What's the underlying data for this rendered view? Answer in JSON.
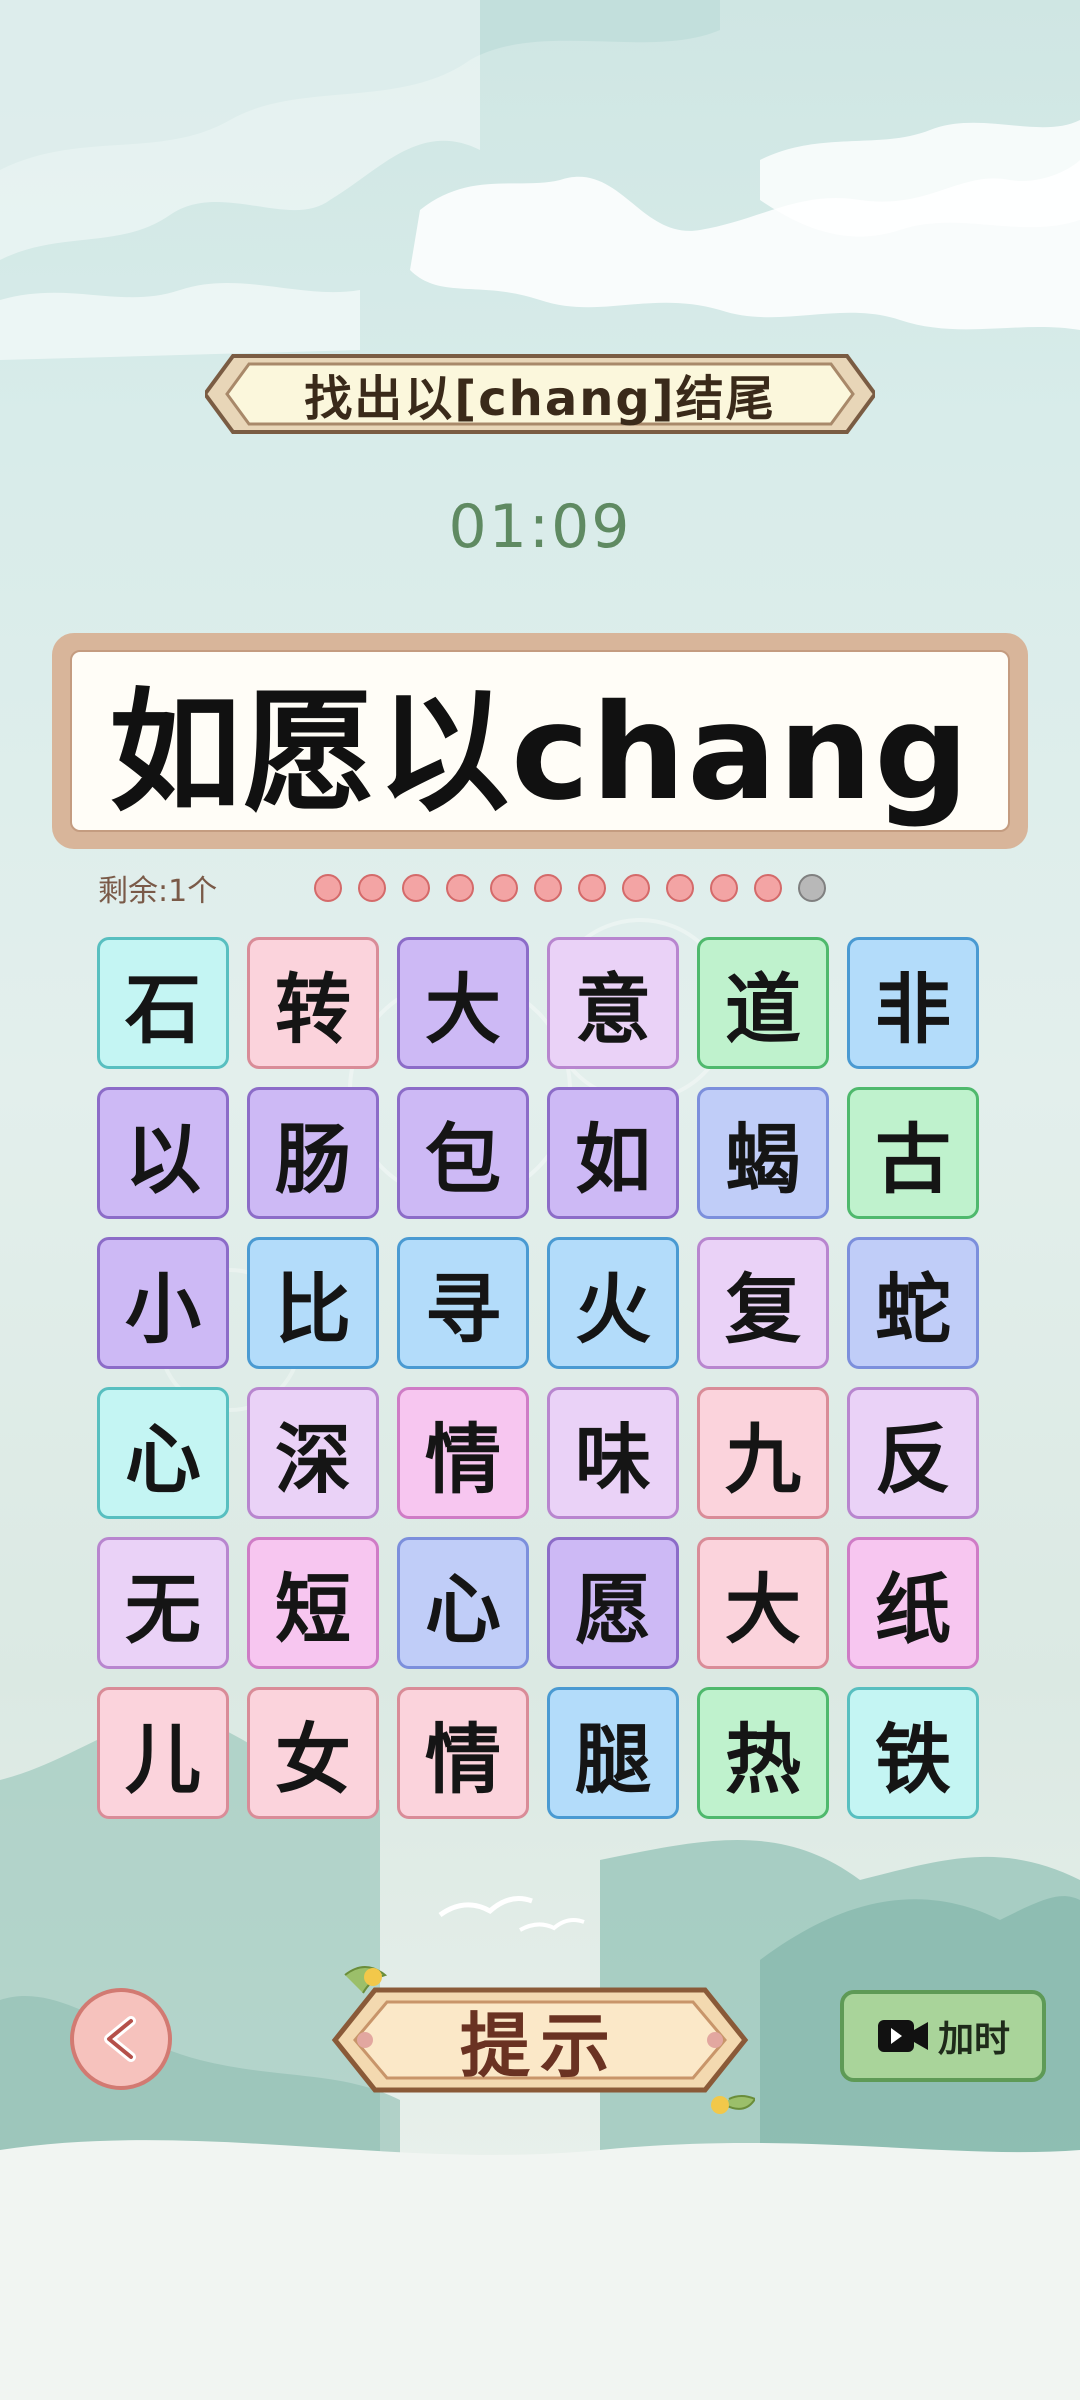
{
  "header": {
    "title": "找出以[chang]结尾",
    "timer": "01:09"
  },
  "answer": {
    "text": "如愿以chang"
  },
  "progress": {
    "remaining_label": "剩余:1个",
    "total": 12,
    "completed": 11
  },
  "grid": {
    "rows": [
      [
        "石",
        "转",
        "大",
        "意",
        "道",
        "非"
      ],
      [
        "以",
        "肠",
        "包",
        "如",
        "蝎",
        "古"
      ],
      [
        "小",
        "比",
        "寻",
        "火",
        "复",
        "蛇"
      ],
      [
        "心",
        "深",
        "情",
        "味",
        "九",
        "反"
      ],
      [
        "无",
        "短",
        "心",
        "愿",
        "大",
        "纸"
      ],
      [
        "儿",
        "女",
        "情",
        "腿",
        "热",
        "铁"
      ]
    ],
    "colors": [
      [
        "cyan",
        "pink",
        "purple",
        "lilac",
        "green",
        "blue"
      ],
      [
        "purple",
        "purple",
        "purple",
        "purple",
        "periw",
        "green"
      ],
      [
        "purple",
        "blue",
        "blue",
        "blue",
        "lilac",
        "periw"
      ],
      [
        "cyan",
        "lilac",
        "magenta",
        "lilac",
        "pink",
        "lilac"
      ],
      [
        "lilac",
        "magenta",
        "periw",
        "purple",
        "pink",
        "magenta"
      ],
      [
        "pink",
        "pink",
        "pink",
        "blue",
        "green",
        "cyan"
      ]
    ]
  },
  "footer": {
    "back_icon": "back-arrow-icon",
    "hint_label": "提示",
    "addtime_label": "加时",
    "addtime_icon": "video-camera-icon"
  }
}
